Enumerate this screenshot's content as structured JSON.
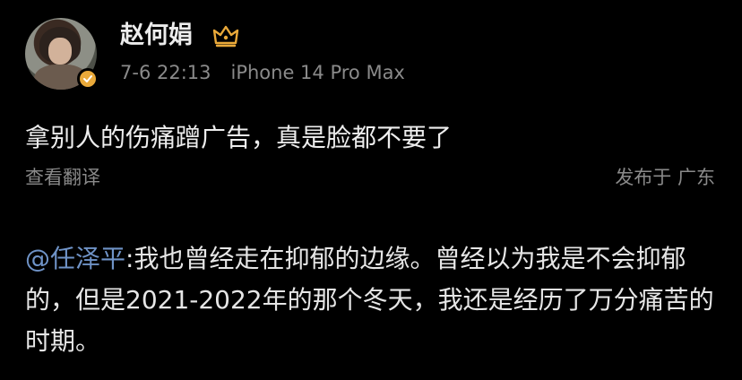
{
  "user": {
    "name": "赵何娟",
    "avatar_icon": "avatar-photo",
    "badge_icon": "verified-badge-icon",
    "vip_icon": "crown-icon",
    "accent_color": "#e9a93a"
  },
  "post": {
    "date": "7-6 22:13",
    "device": "iPhone 14 Pro Max",
    "text": "拿别人的伤痛蹭广告，真是脸都不要了",
    "translate_label": "查看翻译",
    "location_prefix": "发布于",
    "location": "广东"
  },
  "repost": {
    "mention": "@任泽平",
    "text": ":我也曾经走在抑郁的边缘。曾经以为我是不会抑郁的，但是2021-2022年的那个冬天，我还是经历了万分痛苦的时期。",
    "mention_color": "#6f93c7"
  }
}
